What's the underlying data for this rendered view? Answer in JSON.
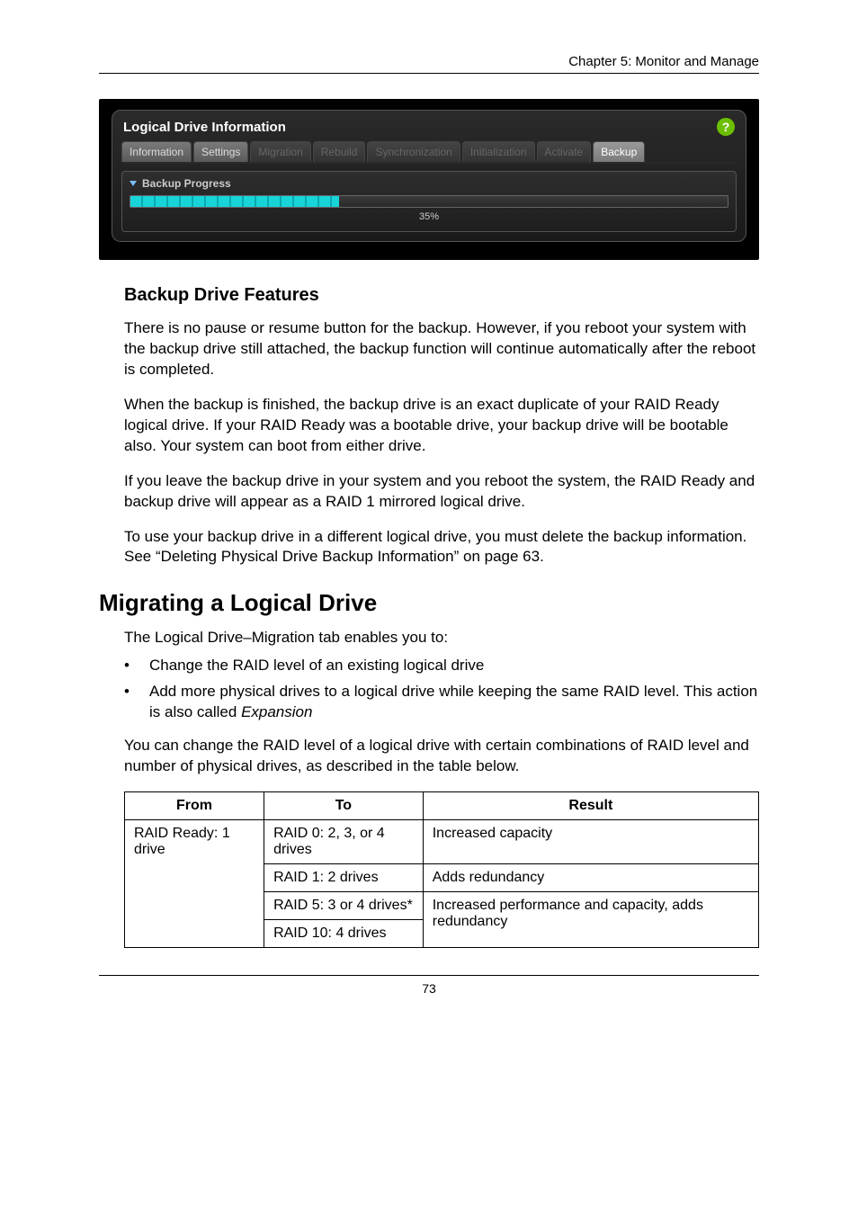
{
  "chapter_header": "Chapter 5: Monitor and Manage",
  "screenshot": {
    "panel_title": "Logical Drive Information",
    "help": "?",
    "tabs": {
      "information": "Information",
      "settings": "Settings",
      "migration": "Migration",
      "rebuild": "Rebuild",
      "synchronization": "Synchronization",
      "initialization": "Initialization",
      "activate": "Activate",
      "backup": "Backup"
    },
    "progress_label": "Backup Progress",
    "progress_pct": "35%"
  },
  "section_backup_features": {
    "heading": "Backup Drive Features",
    "p1": "There is no pause or resume button for the backup. However, if you reboot your system with the backup drive still attached, the backup function will continue automatically after the reboot is completed.",
    "p2": "When the backup is finished, the backup drive is an exact duplicate of your RAID Ready logical drive. If your RAID Ready was a bootable drive, your backup drive will be bootable also. Your system can boot from either drive.",
    "p3": "If you leave the backup drive in your system and you reboot the system, the RAID Ready and backup drive will appear as a RAID 1 mirrored logical drive.",
    "p4": "To use your backup drive in a different logical drive, you must delete the backup information. See “Deleting Physical Drive Backup Information” on page 63."
  },
  "section_migrating": {
    "heading": "Migrating a Logical Drive",
    "intro": "The Logical Drive–Migration tab enables you to:",
    "bullet1": "Change the RAID level of an existing logical drive",
    "bullet2_pre": "Add more physical drives to a logical drive while keeping the same RAID level. This action is also called ",
    "bullet2_em": "Expansion",
    "para2": "You can change the RAID level of a logical drive with certain combinations of RAID level and number of physical drives, as described in the table below."
  },
  "table": {
    "h_from": "From",
    "h_to": "To",
    "h_result": "Result",
    "from1": "RAID Ready: 1 drive",
    "to1": "RAID 0: 2, 3, or 4 drives",
    "res1": "Increased capacity",
    "to2": "RAID 1: 2 drives",
    "res2": "Adds redundancy",
    "to3": "RAID 5: 3 or 4 drives*",
    "res3": "Increased performance and capacity, adds redundancy",
    "to4": "RAID 10: 4 drives"
  },
  "page_number": "73"
}
